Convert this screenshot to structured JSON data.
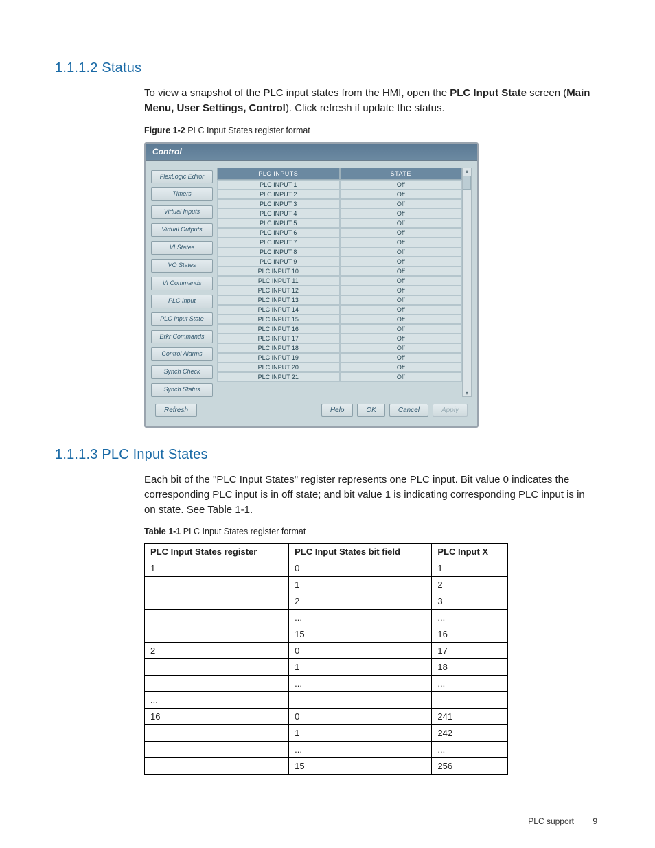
{
  "sec1": {
    "num": "1.1.1.2",
    "title": "Status"
  },
  "p1a": "To view a snapshot of the PLC input states from the HMI, open the ",
  "p1b": "PLC Input State",
  "p1c": " screen (",
  "p1d": "Main Menu, User Settings, Control",
  "p1e": "). Click refresh if update the status.",
  "figcap": {
    "bold": "Figure 1-2",
    "rest": "  PLC Input States register format"
  },
  "panel": {
    "title": "Control",
    "nav": [
      "FlexLogic Editor",
      "Timers",
      "Virtual Inputs",
      "Virtual Outputs",
      "VI States",
      "VO States",
      "VI Commands",
      "PLC Input",
      "PLC Input State",
      "Brkr Commands",
      "Control Alarms",
      "Synch Check",
      "Synch Status"
    ],
    "head": {
      "c1": "PLC INPUTS",
      "c2": "STATE"
    },
    "rows": [
      {
        "c1": "PLC INPUT 1",
        "c2": "Off"
      },
      {
        "c1": "PLC INPUT 2",
        "c2": "Off"
      },
      {
        "c1": "PLC INPUT 3",
        "c2": "Off"
      },
      {
        "c1": "PLC INPUT 4",
        "c2": "Off"
      },
      {
        "c1": "PLC INPUT 5",
        "c2": "Off"
      },
      {
        "c1": "PLC INPUT 6",
        "c2": "Off"
      },
      {
        "c1": "PLC INPUT 7",
        "c2": "Off"
      },
      {
        "c1": "PLC INPUT 8",
        "c2": "Off"
      },
      {
        "c1": "PLC INPUT 9",
        "c2": "Off"
      },
      {
        "c1": "PLC INPUT 10",
        "c2": "Off"
      },
      {
        "c1": "PLC INPUT 11",
        "c2": "Off"
      },
      {
        "c1": "PLC INPUT 12",
        "c2": "Off"
      },
      {
        "c1": "PLC INPUT 13",
        "c2": "Off"
      },
      {
        "c1": "PLC INPUT 14",
        "c2": "Off"
      },
      {
        "c1": "PLC INPUT 15",
        "c2": "Off"
      },
      {
        "c1": "PLC INPUT 16",
        "c2": "Off"
      },
      {
        "c1": "PLC INPUT 17",
        "c2": "Off"
      },
      {
        "c1": "PLC INPUT 18",
        "c2": "Off"
      },
      {
        "c1": "PLC INPUT 19",
        "c2": "Off"
      },
      {
        "c1": "PLC INPUT 20",
        "c2": "Off"
      },
      {
        "c1": "PLC INPUT 21",
        "c2": "Off"
      }
    ],
    "refresh": "Refresh",
    "help": "Help",
    "ok": "OK",
    "cancel": "Cancel",
    "apply": "Apply"
  },
  "sec2": {
    "num": "1.1.1.3",
    "title": "PLC Input States"
  },
  "p2": "Each bit of the \"PLC Input States\" register represents one PLC input. Bit value 0 indicates the corresponding PLC input is in off state; and bit value 1 is indicating corresponding PLC input is in on state. See Table 1-1.",
  "tblcap": {
    "bold": "Table 1-1",
    "rest": "  PLC Input States register format"
  },
  "tbl": {
    "h1": "PLC Input States register",
    "h2": "PLC Input States bit field",
    "h3": "PLC Input X",
    "rows": [
      {
        "a": "1",
        "b": "0",
        "c": "1"
      },
      {
        "a": "",
        "b": "1",
        "c": "2"
      },
      {
        "a": "",
        "b": "2",
        "c": "3"
      },
      {
        "a": "",
        "b": "...",
        "c": "..."
      },
      {
        "a": "",
        "b": "15",
        "c": "16"
      },
      {
        "a": "2",
        "b": "0",
        "c": "17"
      },
      {
        "a": "",
        "b": "1",
        "c": "18"
      },
      {
        "a": "",
        "b": "...",
        "c": "..."
      },
      {
        "a": "...",
        "b": "",
        "c": ""
      },
      {
        "a": "16",
        "b": "0",
        "c": "241"
      },
      {
        "a": "",
        "b": "1",
        "c": "242"
      },
      {
        "a": "",
        "b": "...",
        "c": "..."
      },
      {
        "a": "",
        "b": "15",
        "c": "256"
      }
    ]
  },
  "footer": {
    "label": "PLC support",
    "page": "9"
  }
}
